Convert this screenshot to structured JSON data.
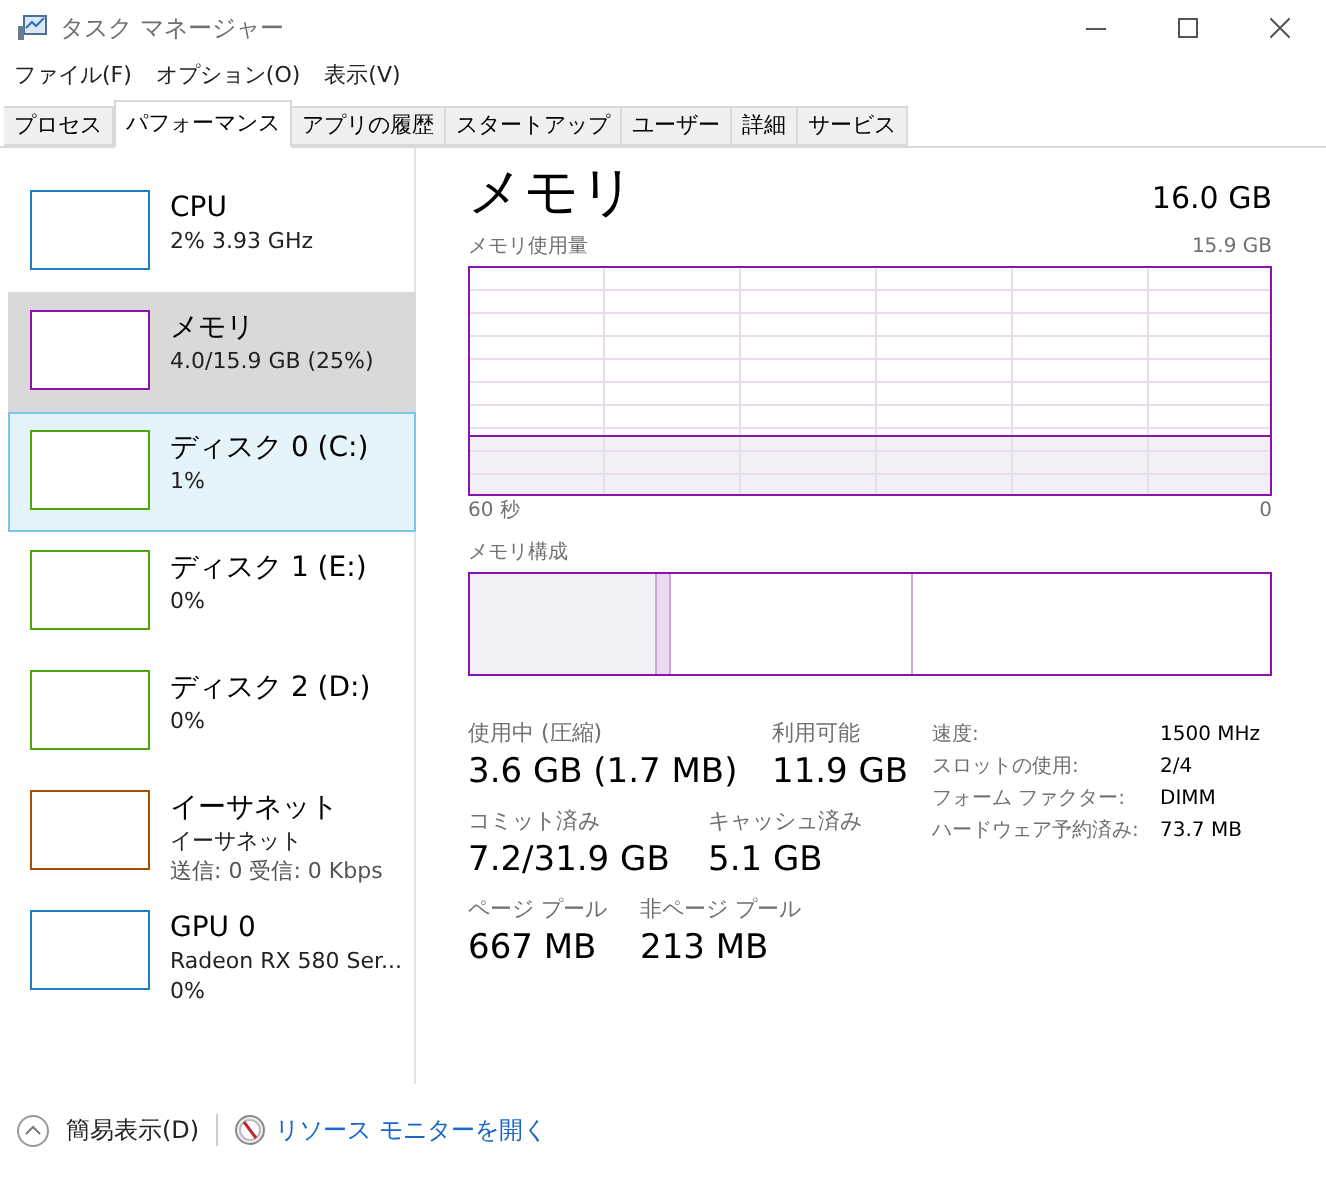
{
  "window": {
    "title": "タスク マネージャー"
  },
  "menu": [
    "ファイル(F)",
    "オプション(O)",
    "表示(V)"
  ],
  "tabs": [
    {
      "label": "プロセス",
      "selected": false
    },
    {
      "label": "パフォーマンス",
      "selected": true
    },
    {
      "label": "アプリの履歴",
      "selected": false
    },
    {
      "label": "スタートアップ",
      "selected": false
    },
    {
      "label": "ユーザー",
      "selected": false
    },
    {
      "label": "詳細",
      "selected": false
    },
    {
      "label": "サービス",
      "selected": false
    }
  ],
  "sidebar": {
    "items": [
      {
        "title": "CPU",
        "lines": [
          "2%  3.93 GHz"
        ],
        "color": "#1c7ec2",
        "selected": false,
        "hovered": false
      },
      {
        "title": "メモリ",
        "lines": [
          "4.0/15.9 GB (25%)"
        ],
        "color": "#8b12ae",
        "selected": true,
        "hovered": false
      },
      {
        "title": "ディスク 0 (C:)",
        "lines": [
          "1%"
        ],
        "color": "#4da60c",
        "selected": false,
        "hovered": true
      },
      {
        "title": "ディスク 1 (E:)",
        "lines": [
          "0%"
        ],
        "color": "#4da60c",
        "selected": false,
        "hovered": false
      },
      {
        "title": "ディスク 2 (D:)",
        "lines": [
          "0%"
        ],
        "color": "#4da60c",
        "selected": false,
        "hovered": false
      },
      {
        "title": "イーサネット",
        "lines": [
          "イーサネット",
          "送信: 0 受信: 0 Kbps"
        ],
        "color": "#a74f01",
        "selected": false,
        "hovered": false
      },
      {
        "title": "GPU 0",
        "lines": [
          "Radeon RX 580 Ser...",
          "0%"
        ],
        "color": "#1c7ec2",
        "selected": false,
        "hovered": false
      }
    ]
  },
  "detail": {
    "title": "メモリ",
    "total": "16.0 GB",
    "usage_graph": {
      "label": "メモリ使用量",
      "max": "15.9 GB",
      "x_start": "60 秒",
      "x_end": "0"
    },
    "composition": {
      "label": "メモリ構成"
    },
    "stats": [
      {
        "label": "使用中 (圧縮)",
        "value": "3.6 GB (1.7 MB)"
      },
      {
        "label": "利用可能",
        "value": "11.9 GB"
      },
      {
        "label": "コミット済み",
        "value": "7.2/31.9 GB"
      },
      {
        "label": "キャッシュ済み",
        "value": "5.1 GB"
      },
      {
        "label": "ページ プール",
        "value": "667 MB"
      },
      {
        "label": "非ページ プール",
        "value": "213 MB"
      }
    ],
    "properties": [
      {
        "label": "速度:",
        "value": "1500 MHz"
      },
      {
        "label": "スロットの使用:",
        "value": "2/4"
      },
      {
        "label": "フォーム ファクター:",
        "value": "DIMM"
      },
      {
        "label": "ハードウェア予約済み:",
        "value": "73.7 MB"
      }
    ]
  },
  "footer": {
    "fewer_details": "簡易表示(D)",
    "resource_monitor": "リソース モニターを開く"
  }
}
